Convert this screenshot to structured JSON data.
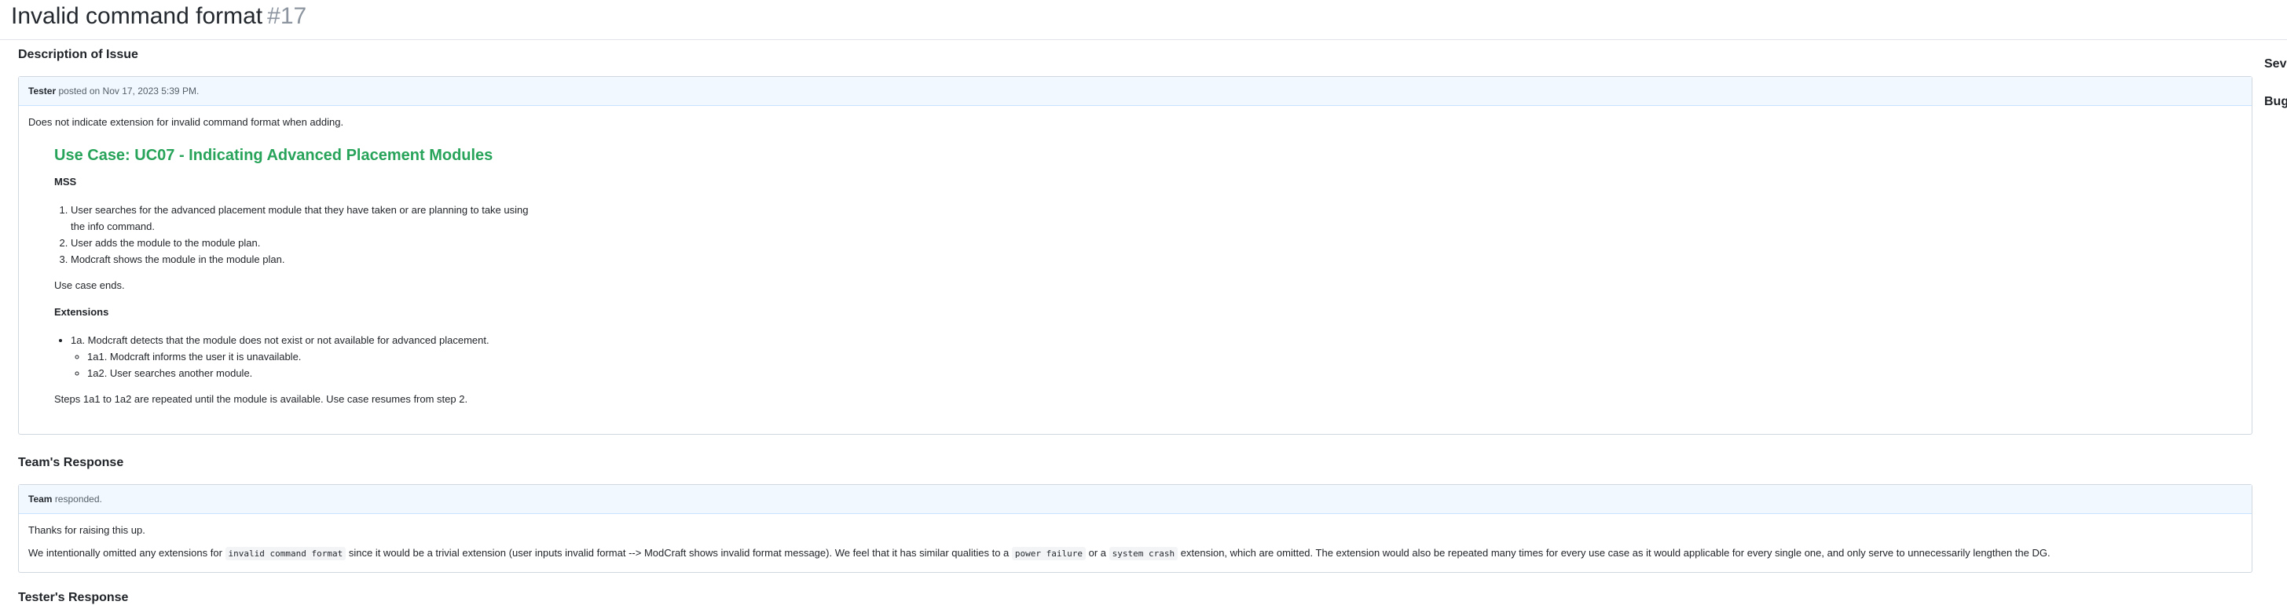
{
  "issue": {
    "title": "Invalid command format",
    "number": "#17"
  },
  "description": {
    "heading": "Description of Issue",
    "author": "Tester",
    "posted_text": "posted on Nov 17, 2023 5:39 PM.",
    "intro": "Does not indicate extension for invalid command format when adding.",
    "use_case_title": "Use Case: UC07 - Indicating Advanced Placement Modules",
    "mss_heading": "MSS",
    "mss_steps": [
      "User searches for the advanced placement module that they have taken or are planning to take using the info command.",
      "User adds the module to the module plan.",
      "Modcraft shows the module in the module plan."
    ],
    "use_case_ends": "Use case ends.",
    "extensions_heading": "Extensions",
    "extension_main": "1a. Modcraft detects that the module does not exist or not available for advanced placement.",
    "extension_subs": [
      "1a1. Modcraft informs the user it is unavailable.",
      "1a2. User searches another module."
    ],
    "closing": "Steps 1a1 to 1a2 are repeated until the module is available. Use case resumes from step 2."
  },
  "team_response": {
    "heading": "Team's Response",
    "author": "Team",
    "posted_text": "responded.",
    "thanks": "Thanks for raising this up.",
    "text_1": "We intentionally omitted any extensions for",
    "code_1": "invalid command format",
    "text_2": "since it would be a trivial extension (user inputs invalid format --> ModCraft shows invalid format message). We feel that it has similar qualities to a",
    "code_2": "power failure",
    "text_3": "or a",
    "code_3": "system crash",
    "text_4": "extension, which are omitted. The extension would also be repeated many times for every use case as it would applicable for every single one, and only serve to unnecessarily lengthen the DG."
  },
  "tester_response": {
    "heading": "Tester's Response"
  },
  "sidebar": {
    "severity_label": "Seve",
    "type_label": "Bug"
  },
  "colors": {
    "use_case_title": "#27a35a",
    "box_header_bg": "#f1f8ff"
  }
}
